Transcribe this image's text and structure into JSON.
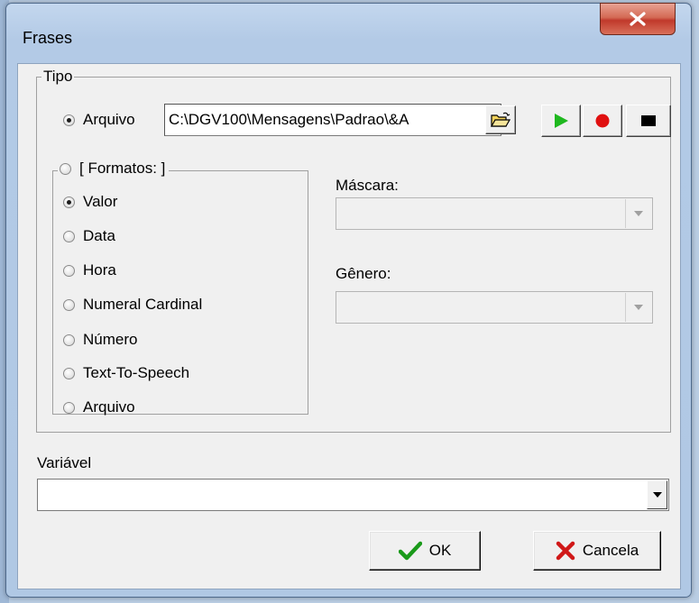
{
  "window": {
    "title": "Frases"
  },
  "tipo": {
    "legend": "Tipo",
    "arquivo_label": "Arquivo",
    "arquivo_path": "C:\\DGV100\\Mensagens\\Padrao\\&A",
    "arquivo_selected": true
  },
  "formatos": {
    "legend": "[ Formatos: ]",
    "options": [
      {
        "label": "Valor",
        "checked": true
      },
      {
        "label": "Data",
        "checked": false
      },
      {
        "label": "Hora",
        "checked": false
      },
      {
        "label": "Numeral Cardinal",
        "checked": false
      },
      {
        "label": "Número",
        "checked": false
      },
      {
        "label": "Text-To-Speech",
        "checked": false
      },
      {
        "label": "Arquivo",
        "checked": false
      }
    ]
  },
  "mascara": {
    "label": "Máscara:",
    "value": ""
  },
  "genero": {
    "label": "Gênero:",
    "value": ""
  },
  "variavel": {
    "label": "Variável",
    "value": ""
  },
  "buttons": {
    "ok": "OK",
    "cancel": "Cancela"
  },
  "colors": {
    "play": "#1fb81f",
    "record": "#e01010",
    "stop": "#000000",
    "close": "#c0392b"
  },
  "icons": [
    "close-icon",
    "folder-open-icon",
    "play-icon",
    "record-icon",
    "stop-icon",
    "checkmark-icon",
    "cross-icon",
    "dropdown-arrow-icon"
  ]
}
